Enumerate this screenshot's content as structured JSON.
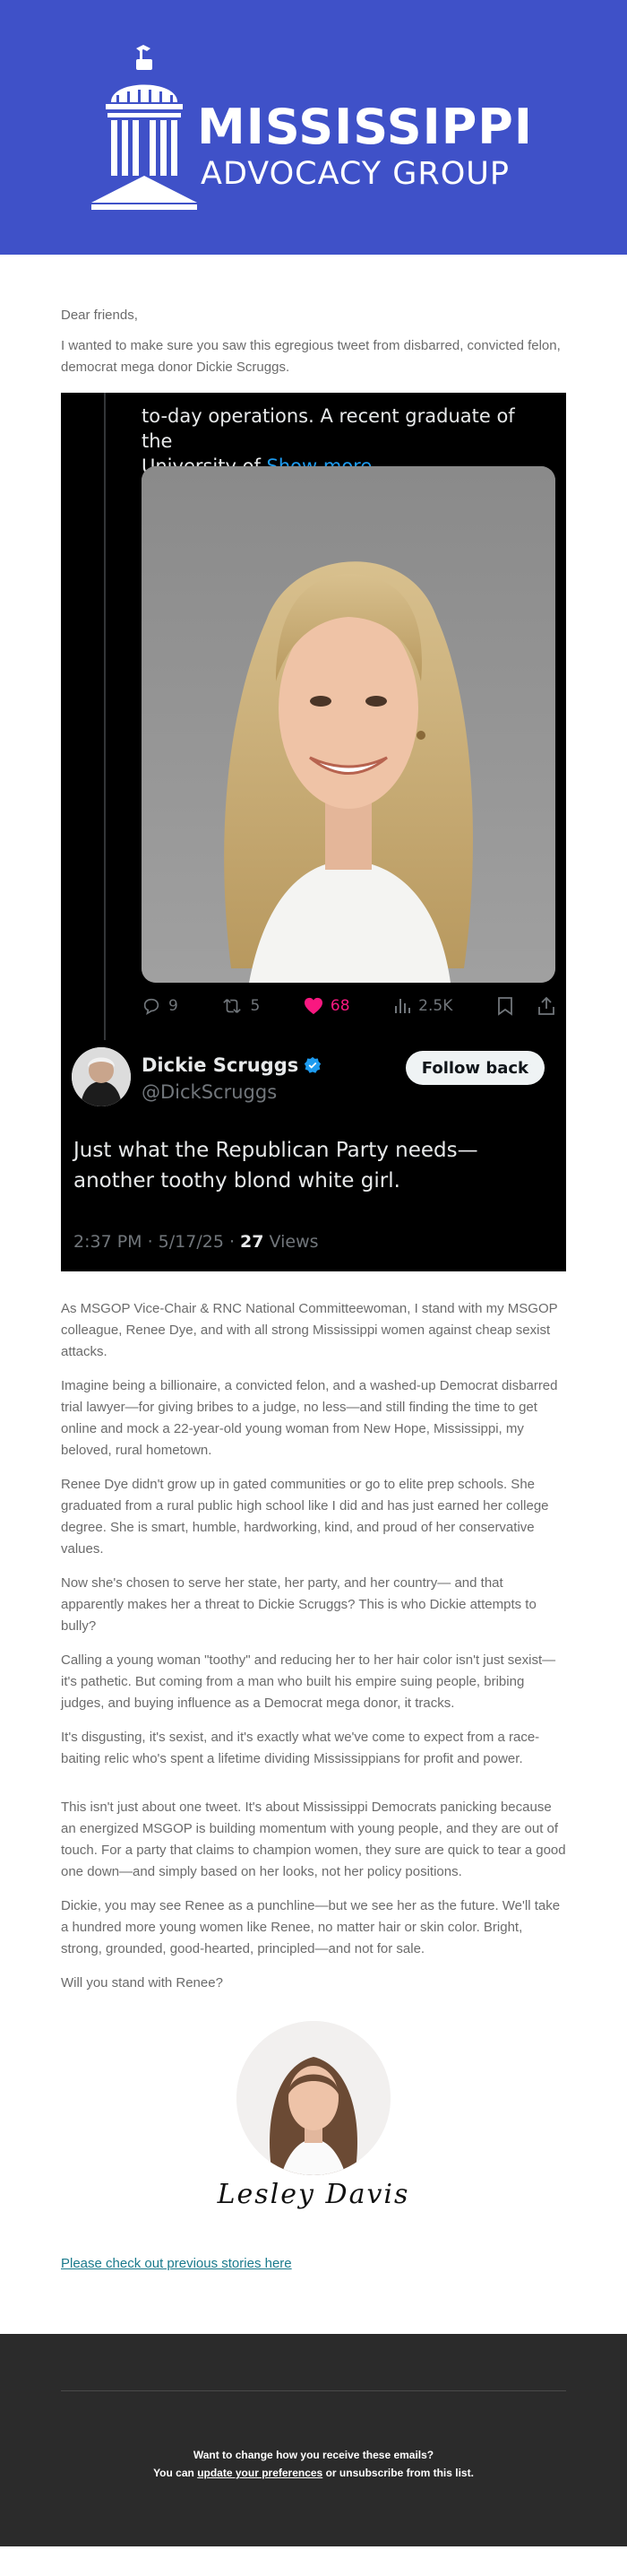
{
  "brand": {
    "title": "MISSISSIPPI",
    "subtitle": "ADVOCACY GROUP",
    "colors": {
      "header": "#3f51c8",
      "footer": "#2b2b2b",
      "link": "#1a7a8c",
      "like": "#f91880",
      "verified": "#1d9bf0"
    }
  },
  "email": {
    "greeting": "Dear friends,",
    "intro": "I wanted to make sure you saw this egregious tweet from disbarred, convicted felon, democrat mega donor Dickie Scruggs."
  },
  "tweet": {
    "quoted_text_cropped": "to-day operations. A recent graduate of the",
    "quoted_text_line2": "University of ",
    "show_more": "Show more",
    "photo_icon": "portrait-photo",
    "stats": {
      "replies": "9",
      "reposts": "5",
      "likes": "68",
      "views": "2.5K"
    },
    "author": {
      "name": "Dickie Scruggs",
      "handle": "@DickScruggs",
      "verified_icon": "verified-badge-icon"
    },
    "follow_label": "Follow back",
    "body": "Just what the Republican Party needs—another toothy blond white girl.",
    "meta_time": "2:37 PM · 5/17/25 · ",
    "meta_views_count": "27",
    "meta_views_label": " Views"
  },
  "body_paragraphs": [
    "As MSGOP Vice-Chair & RNC National Committeewoman, I stand with my MSGOP colleague, Renee Dye, and with all strong Mississippi women against cheap sexist attacks.",
    "Imagine being a billionaire, a convicted felon, and a washed-up Democrat disbarred trial lawyer—for giving bribes to a judge, no less—and still finding the time to get online and mock a 22-year-old young woman from New Hope, Mississippi, my beloved, rural hometown.",
    "Renee Dye didn't grow up in gated communities or go to elite prep schools. She graduated from a rural public high school like I did and has just earned her college degree. She is smart, humble, hardworking, kind, and proud of her conservative values.",
    "Now she's chosen to serve her state, her party, and her country— and that apparently makes her a threat to Dickie Scruggs? This is who Dickie attempts to bully?",
    "Calling a young woman \"toothy\" and reducing her to her hair color isn't just sexist—it's pathetic. But coming from a man who built his empire suing people, bribing judges, and buying influence as a Democrat mega donor, it tracks.",
    "It's disgusting, it's sexist, and it's exactly what we've come to expect from a race-baiting relic who's spent a lifetime dividing Mississippians for profit and power.",
    "This isn't just about one tweet. It's about Mississippi Democrats panicking because an energized MSGOP is building momentum with young people, and they are out of touch.  For a party that claims to champion women, they sure are quick to tear a good one down—and simply based on her looks, not her policy positions.",
    "Dickie, you may see Renee as a punchline—but we see her as the future. We'll take a hundred more young women like Renee, no matter hair or skin color. Bright, strong, grounded, good-hearted, principled—and not for sale.",
    "Will you stand with Renee?"
  ],
  "signature": {
    "name": "Lesley Davis"
  },
  "previous_link": "Please check out previous stories here",
  "footer": {
    "line1": "Want to change how you receive these emails?",
    "line2_prefix": "You can ",
    "line2_link": "update your preferences",
    "line2_suffix": " or unsubscribe from this list."
  }
}
